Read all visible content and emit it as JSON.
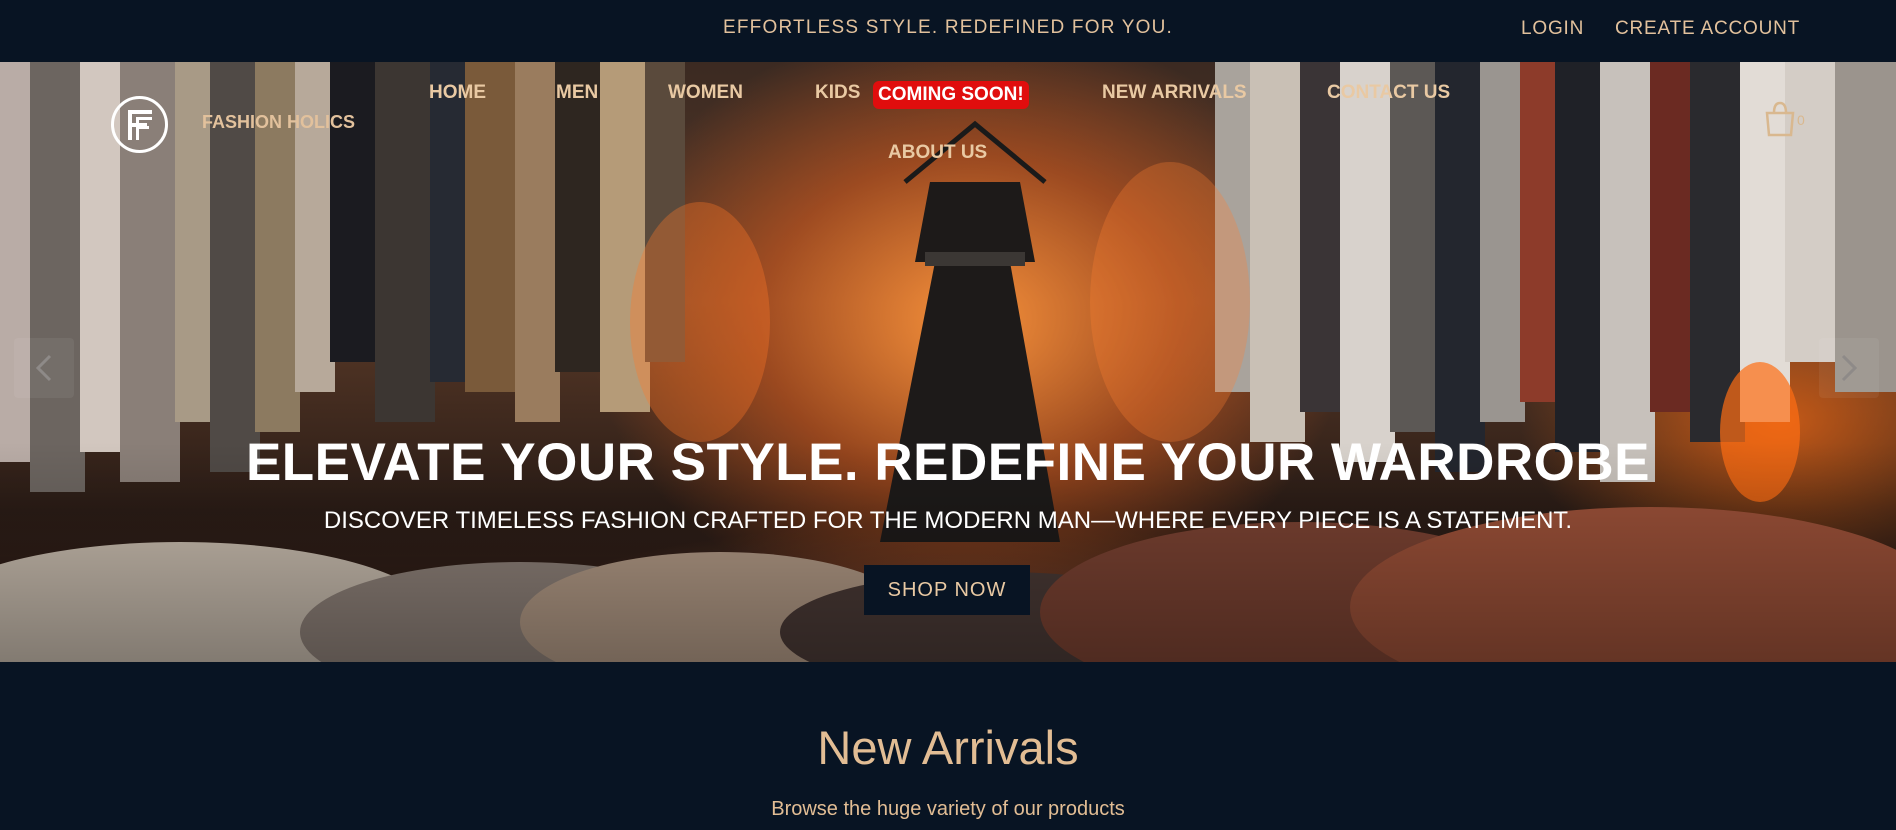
{
  "topbar": {
    "announcement": "EFFORTLESS STYLE. REDEFINED FOR YOU.",
    "login": "LOGIN",
    "create_account": "CREATE ACCOUNT"
  },
  "header": {
    "brand": "FASHION HOLICS",
    "nav": {
      "home": "HOME",
      "men": "MEN",
      "women": "WOMEN",
      "kids": "KIDS",
      "kids_badge": "COMING SOON!",
      "new_arrivals": "NEW ARRIVALS",
      "contact": "CONTACT US",
      "about": "ABOUT US"
    },
    "cart_count": "0",
    "icons": {
      "logo": "ff-monogram-logo",
      "cart": "shopping-bag-icon"
    }
  },
  "hero": {
    "title": "ELEVATE YOUR STYLE. REDEFINE YOUR WARDROBE",
    "subtitle": "DISCOVER TIMELESS FASHION CRAFTED FOR THE MODERN MAN—WHERE EVERY PIECE IS A STATEMENT.",
    "cta": "SHOP NOW",
    "prev_icon": "chevron-left-icon",
    "next_icon": "chevron-right-icon"
  },
  "new_arrivals": {
    "title": "New Arrivals",
    "subtitle": "Browse the huge variety of our products"
  },
  "colors": {
    "navy": "#081423",
    "accent": "#e9c9a3",
    "badge_red": "#e00d0d"
  }
}
